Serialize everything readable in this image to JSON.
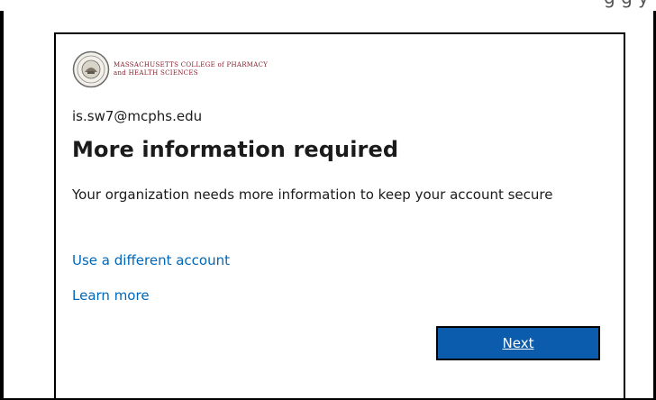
{
  "top_clip": {
    "text": "g   g   y"
  },
  "brand": {
    "logo_line1": "MASSACHUSETTS COLLEGE of PHARMACY",
    "logo_line2": "and HEALTH SCIENCES"
  },
  "account": {
    "email": "is.sw7@mcphs.edu"
  },
  "main": {
    "title": "More information required",
    "description": "Your organization needs more information to keep your account secure",
    "use_different_account": "Use a different account",
    "learn_more": "Learn more",
    "next_label": "Next"
  },
  "colors": {
    "link": "#0067b8",
    "button": "#0b5cad",
    "logo_text": "#8a1d2a"
  }
}
